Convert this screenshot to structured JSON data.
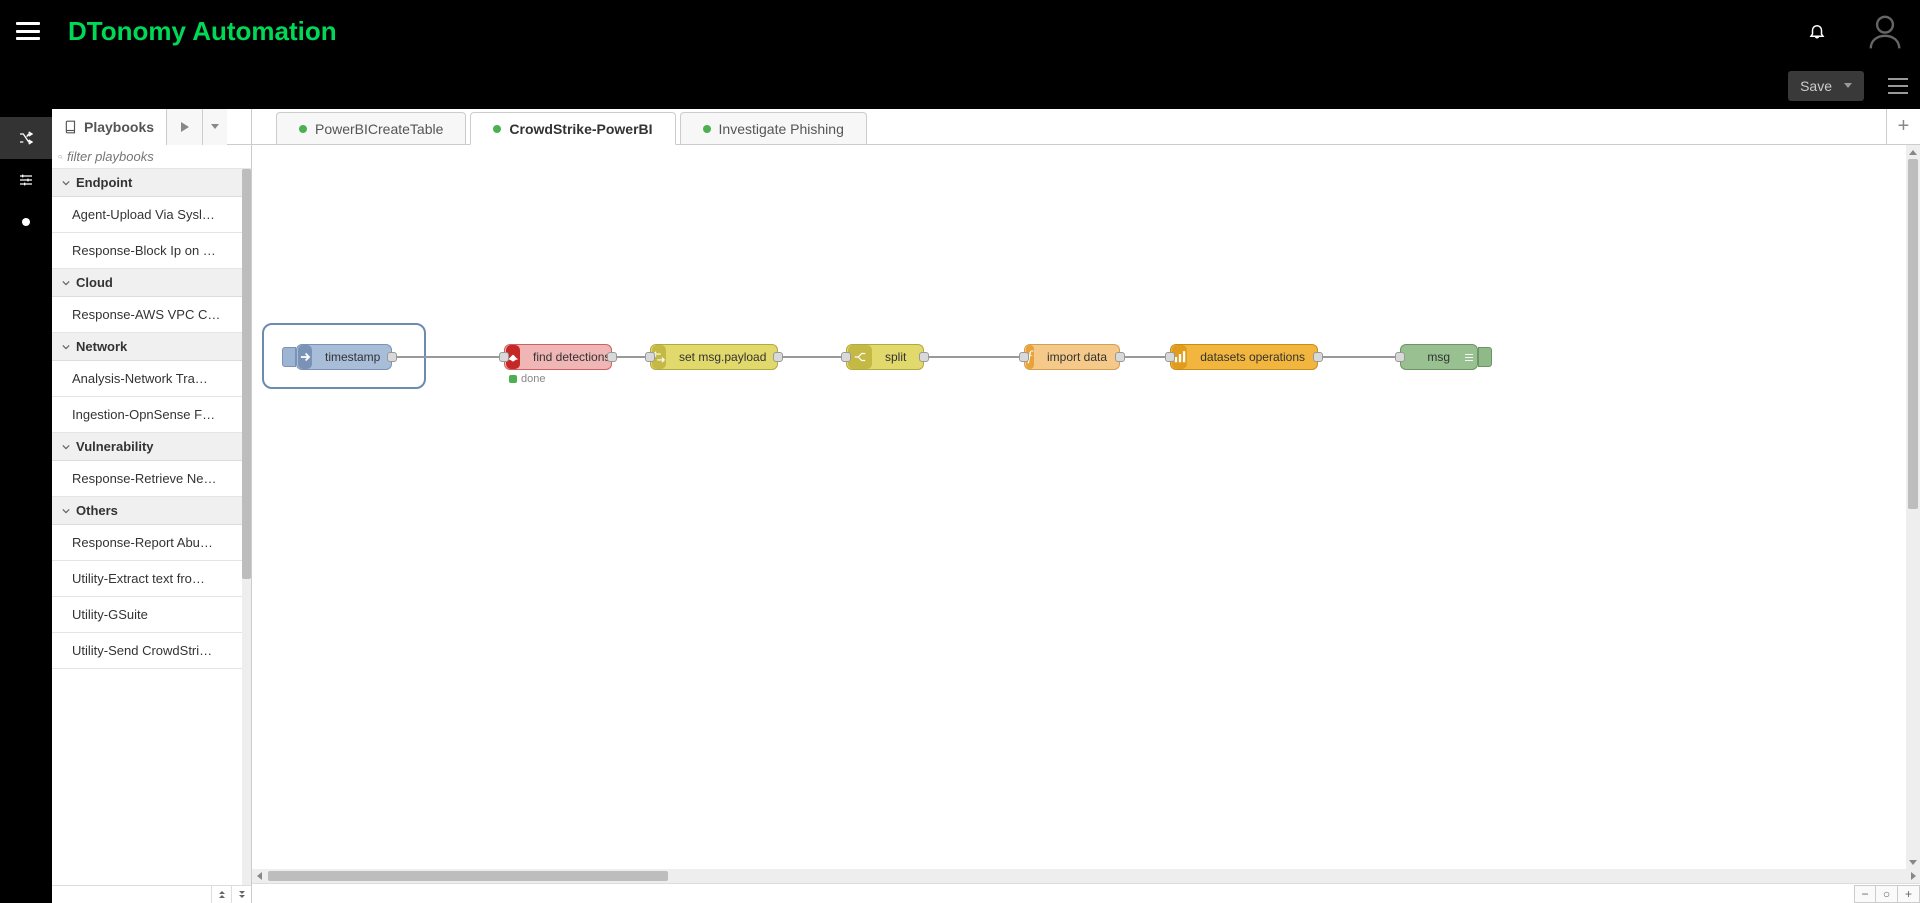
{
  "brand": "DTonomy Automation",
  "actions": {
    "save": "Save"
  },
  "sidebar": {
    "title": "Playbooks",
    "search_placeholder": "filter playbooks",
    "categories": [
      {
        "name": "Endpoint",
        "items": [
          "Agent-Upload Via Sysl…",
          "Response-Block Ip on …"
        ]
      },
      {
        "name": "Cloud",
        "items": [
          "Response-AWS VPC C…"
        ]
      },
      {
        "name": "Network",
        "items": [
          "Analysis-Network Tra…",
          "Ingestion-OpnSense F…"
        ]
      },
      {
        "name": "Vulnerability",
        "items": [
          "Response-Retrieve Ne…"
        ]
      },
      {
        "name": "Others",
        "items": [
          "Response-Report Abu…",
          "Utility-Extract text fro…",
          "Utility-GSuite",
          "Utility-Send CrowdStri…"
        ]
      }
    ]
  },
  "tabs": [
    {
      "label": "PowerBICreateTable",
      "color": "#4caf50",
      "active": false
    },
    {
      "label": "CrowdStrike-PowerBI",
      "color": "#4caf50",
      "active": true
    },
    {
      "label": "Investigate Phishing",
      "color": "#4caf50",
      "active": false
    }
  ],
  "nodes": {
    "timestamp": {
      "label": "timestamp",
      "status": ""
    },
    "find_detections": {
      "label": "find detections",
      "status": "done"
    },
    "set_payload": {
      "label": "set msg.payload"
    },
    "split": {
      "label": "split"
    },
    "import_data": {
      "label": "import data"
    },
    "datasets_ops": {
      "label": "datasets operations"
    },
    "debug_msg": {
      "label": "msg"
    }
  },
  "zoom": {
    "out": "−",
    "reset": "○",
    "in": "+"
  }
}
